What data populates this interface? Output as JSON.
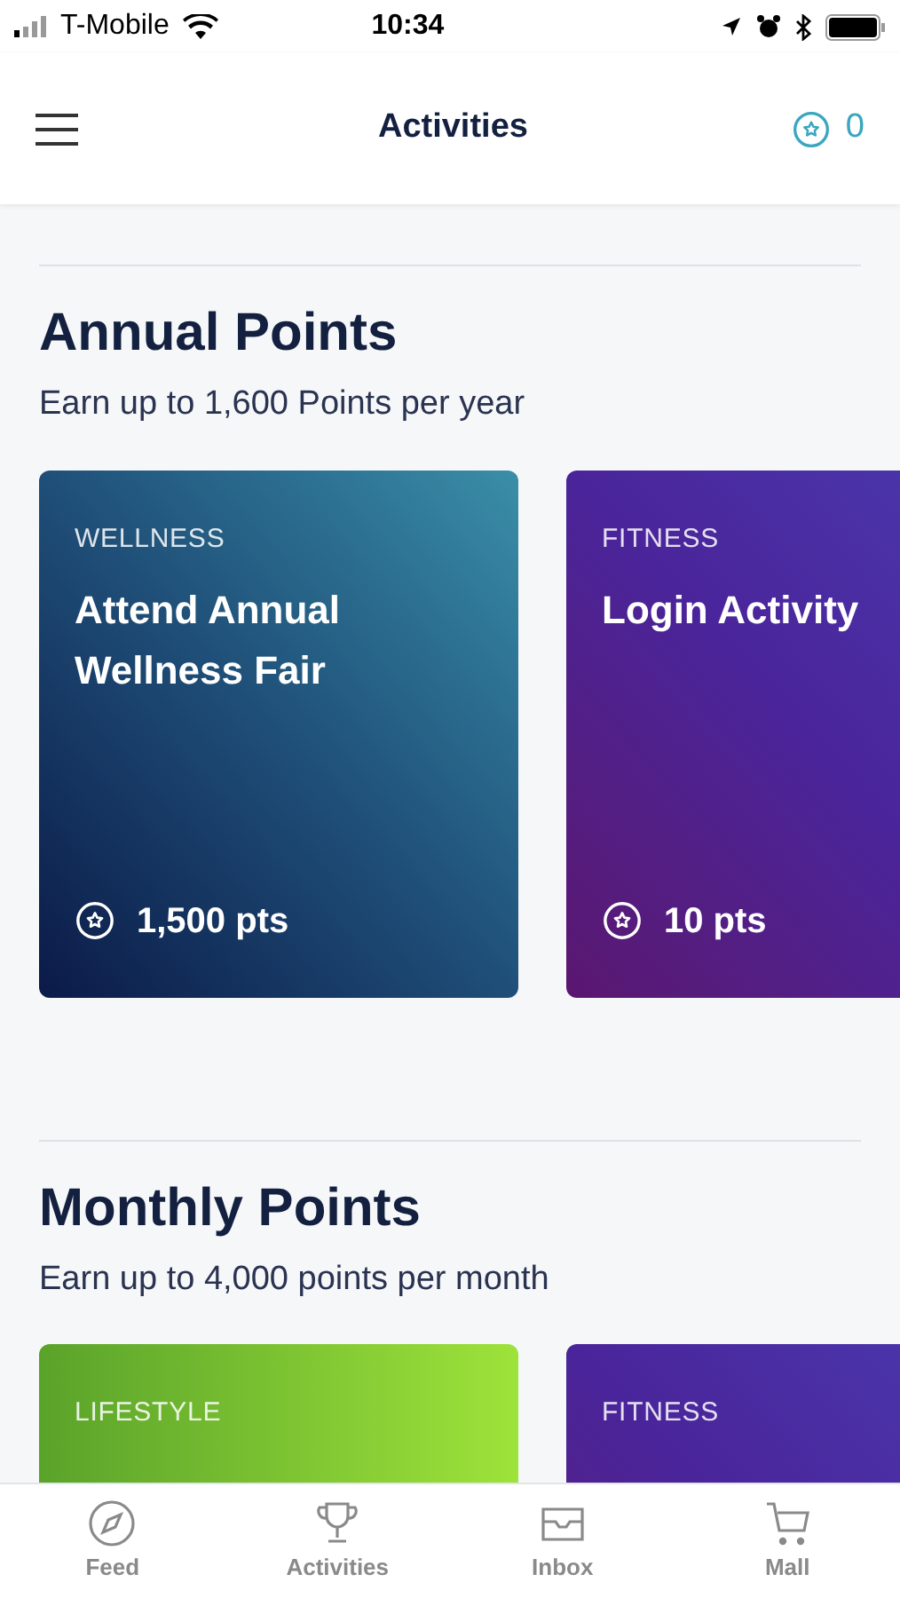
{
  "status_bar": {
    "carrier": "T-Mobile",
    "time": "10:34"
  },
  "header": {
    "title": "Activities",
    "points": "0"
  },
  "sections": [
    {
      "title": "Annual Points",
      "subtitle": "Earn up to 1,600 Points per year",
      "cards": [
        {
          "kind": "teal",
          "category": "WELLNESS",
          "title": "Attend Annual Wellness Fair",
          "points": "1,500 pts"
        },
        {
          "kind": "purple",
          "category": "FITNESS",
          "title": "Login Activity",
          "points": "10 pts"
        }
      ]
    },
    {
      "title": "Monthly Points",
      "subtitle": "Earn up to 4,000 points per month",
      "cards": [
        {
          "kind": "green",
          "category": "LIFESTYLE"
        },
        {
          "kind": "purple",
          "category": "FITNESS"
        }
      ]
    }
  ],
  "tab_bar": [
    {
      "kind": "compass",
      "label": "Feed"
    },
    {
      "kind": "trophy",
      "label": "Activities"
    },
    {
      "kind": "inbox",
      "label": "Inbox"
    },
    {
      "kind": "cart",
      "label": "Mall"
    }
  ]
}
